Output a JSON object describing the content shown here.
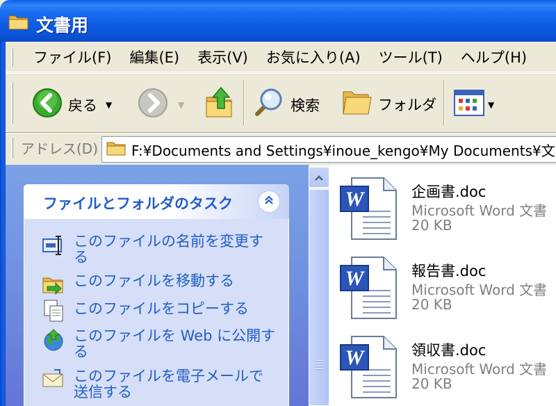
{
  "window": {
    "title": "文書用"
  },
  "menu": {
    "items": [
      "ファイル(F)",
      "編集(E)",
      "表示(V)",
      "お気に入り(A)",
      "ツール(T)",
      "ヘルプ(H)"
    ]
  },
  "toolbar": {
    "back_label": "戻る",
    "search_label": "検索",
    "folders_label": "フォルダ"
  },
  "address": {
    "label": "アドレス(D)",
    "value": "F:¥Documents and Settings¥inoue_kengo¥My Documents¥文"
  },
  "task_pane": {
    "header": "ファイルとフォルダのタスク",
    "tasks": [
      {
        "line1": "このファイルの名前を変更す",
        "line2": "る",
        "icon": "rename-icon"
      },
      {
        "line1": "このファイルを移動する",
        "line2": "",
        "icon": "move-icon"
      },
      {
        "line1": "このファイルをコピーする",
        "line2": "",
        "icon": "copy-icon"
      },
      {
        "line1": "このファイルを Web に公開す",
        "line2": "る",
        "icon": "web-publish-icon"
      },
      {
        "line1": "このファイルを電子メールで",
        "line2": "送信する",
        "icon": "email-icon"
      }
    ]
  },
  "files": [
    {
      "name": "企画書.doc",
      "type": "Microsoft Word 文書",
      "size": "20 KB",
      "icon": "word-document-icon"
    },
    {
      "name": "報告書.doc",
      "type": "Microsoft Word 文書",
      "size": "20 KB",
      "icon": "word-document-icon"
    },
    {
      "name": "領収書.doc",
      "type": "Microsoft Word 文書",
      "size": "20 KB",
      "icon": "word-document-icon"
    }
  ],
  "colors": {
    "titlebar": "#0F5CE3",
    "task_link": "#215DC6",
    "task_pane_bg": "#6F8FE0"
  }
}
